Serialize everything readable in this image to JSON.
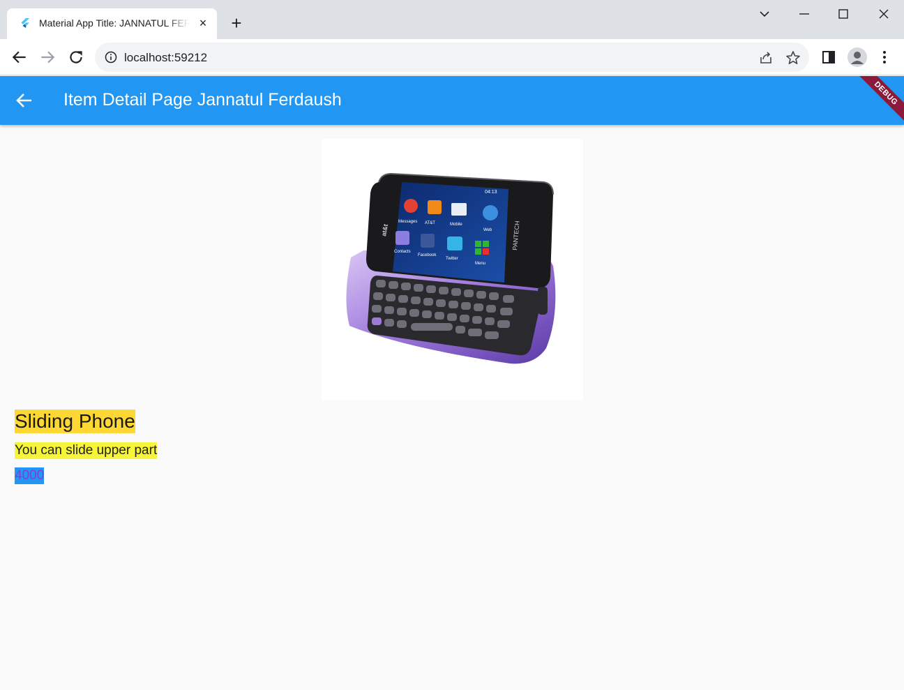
{
  "browser": {
    "tab_title": "Material App Title: JANNATUL FERDAUSH",
    "tab_close": "×",
    "new_tab": "+",
    "url": "localhost:59212"
  },
  "appbar": {
    "title": "Item Detail Page Jannatul Ferdaush",
    "debug_label": "DEBUG",
    "color": "#2196f3"
  },
  "product": {
    "name": "Sliding Phone",
    "description": "You can slide upper part",
    "price": "4000",
    "image_alt": "sliding-phone-image",
    "phone_screen_labels": [
      "Messages",
      "AT&T Social Net",
      "Mobile Email",
      "Web",
      "Contacts",
      "Facebook",
      "Twitter",
      "Menu"
    ],
    "phone_brand_labels": [
      "at&t",
      "PANTECH"
    ],
    "phone_clock": "04:13"
  },
  "colors": {
    "name_highlight": "#fdd835",
    "description_highlight": "#f7f53a",
    "price_highlight": "#2196f3",
    "price_text": "#7e3fd8"
  }
}
